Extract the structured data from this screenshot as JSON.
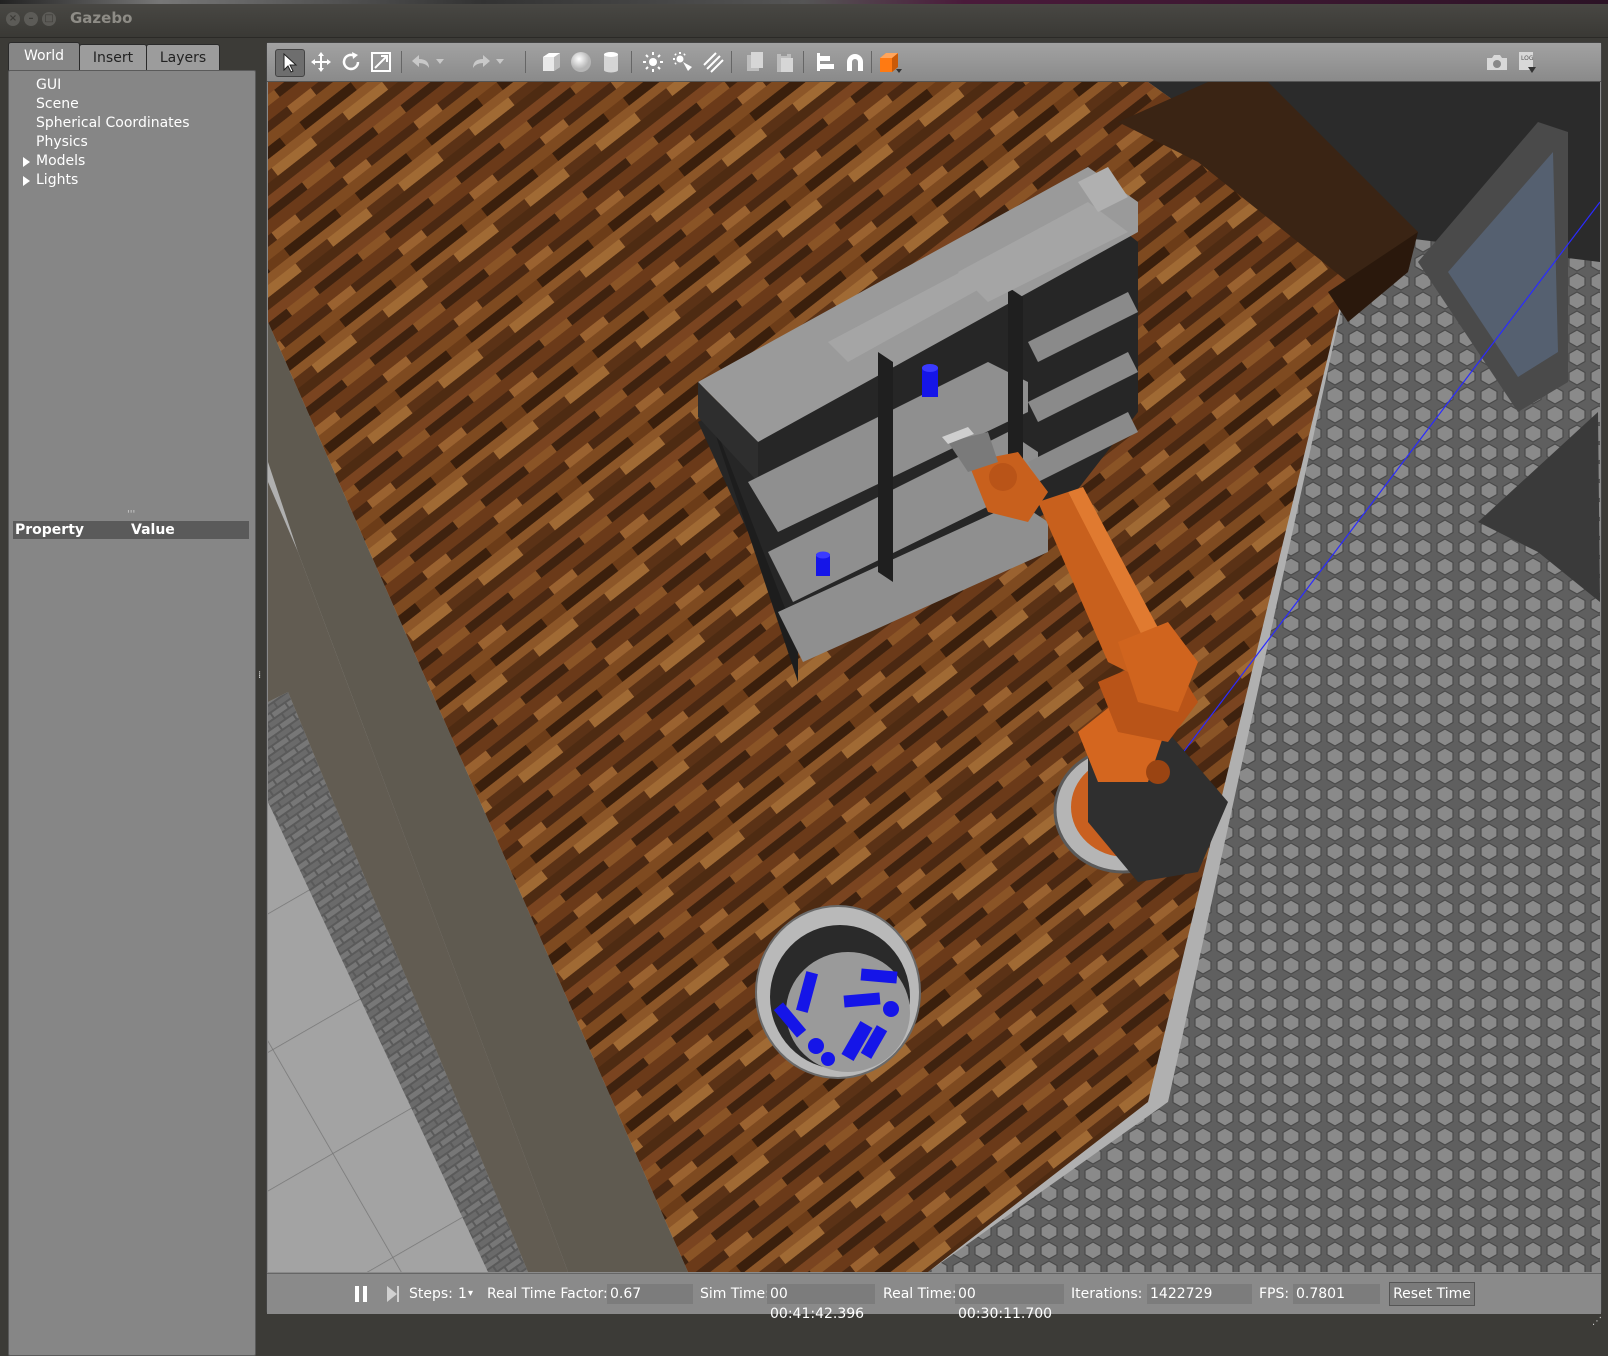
{
  "window": {
    "title": "Gazebo"
  },
  "left_panel": {
    "tabs": [
      {
        "label": "World"
      },
      {
        "label": "Insert"
      },
      {
        "label": "Layers"
      }
    ],
    "tree": [
      {
        "label": "GUI",
        "expandable": false
      },
      {
        "label": "Scene",
        "expandable": false
      },
      {
        "label": "Spherical Coordinates",
        "expandable": false
      },
      {
        "label": "Physics",
        "expandable": false
      },
      {
        "label": "Models",
        "expandable": true
      },
      {
        "label": "Lights",
        "expandable": true
      }
    ],
    "property_header": {
      "property": "Property",
      "value": "Value"
    }
  },
  "toolbar": {
    "tools": [
      "select-arrow-icon",
      "translate-icon",
      "rotate-icon",
      "scale-icon",
      "undo-icon",
      "redo-icon",
      "box-shape-icon",
      "sphere-shape-icon",
      "cylinder-shape-icon",
      "point-light-icon",
      "spot-light-icon",
      "directional-light-icon",
      "copy-icon",
      "paste-icon",
      "align-icon",
      "snap-magnet-icon",
      "view-angle-icon",
      "screenshot-icon",
      "log-icon"
    ],
    "accent_color": "#ff7a12"
  },
  "status": {
    "steps_label": "Steps:",
    "steps_value": "1",
    "rtf_label": "Real Time Factor:",
    "rtf_value": "0.67",
    "sim_time_label": "Sim Time:",
    "sim_time_value": "00 00:41:42.396",
    "real_time_label": "Real Time:",
    "real_time_value": "00 00:30:11.700",
    "iterations_label": "Iterations:",
    "iterations_value": "1422729",
    "fps_label": "FPS:",
    "fps_value": "0.7801",
    "reset_label": "Reset Time"
  },
  "scene": {
    "objects": [
      "wooden-floor",
      "bookshelf",
      "kuka-robot-arm",
      "drop-bin",
      "blue-cylinders",
      "tiled-floor",
      "wall"
    ],
    "colors": {
      "robot": "#d4661f",
      "cylinders": "#1515e8",
      "shelf": "#9a9a9a"
    }
  }
}
